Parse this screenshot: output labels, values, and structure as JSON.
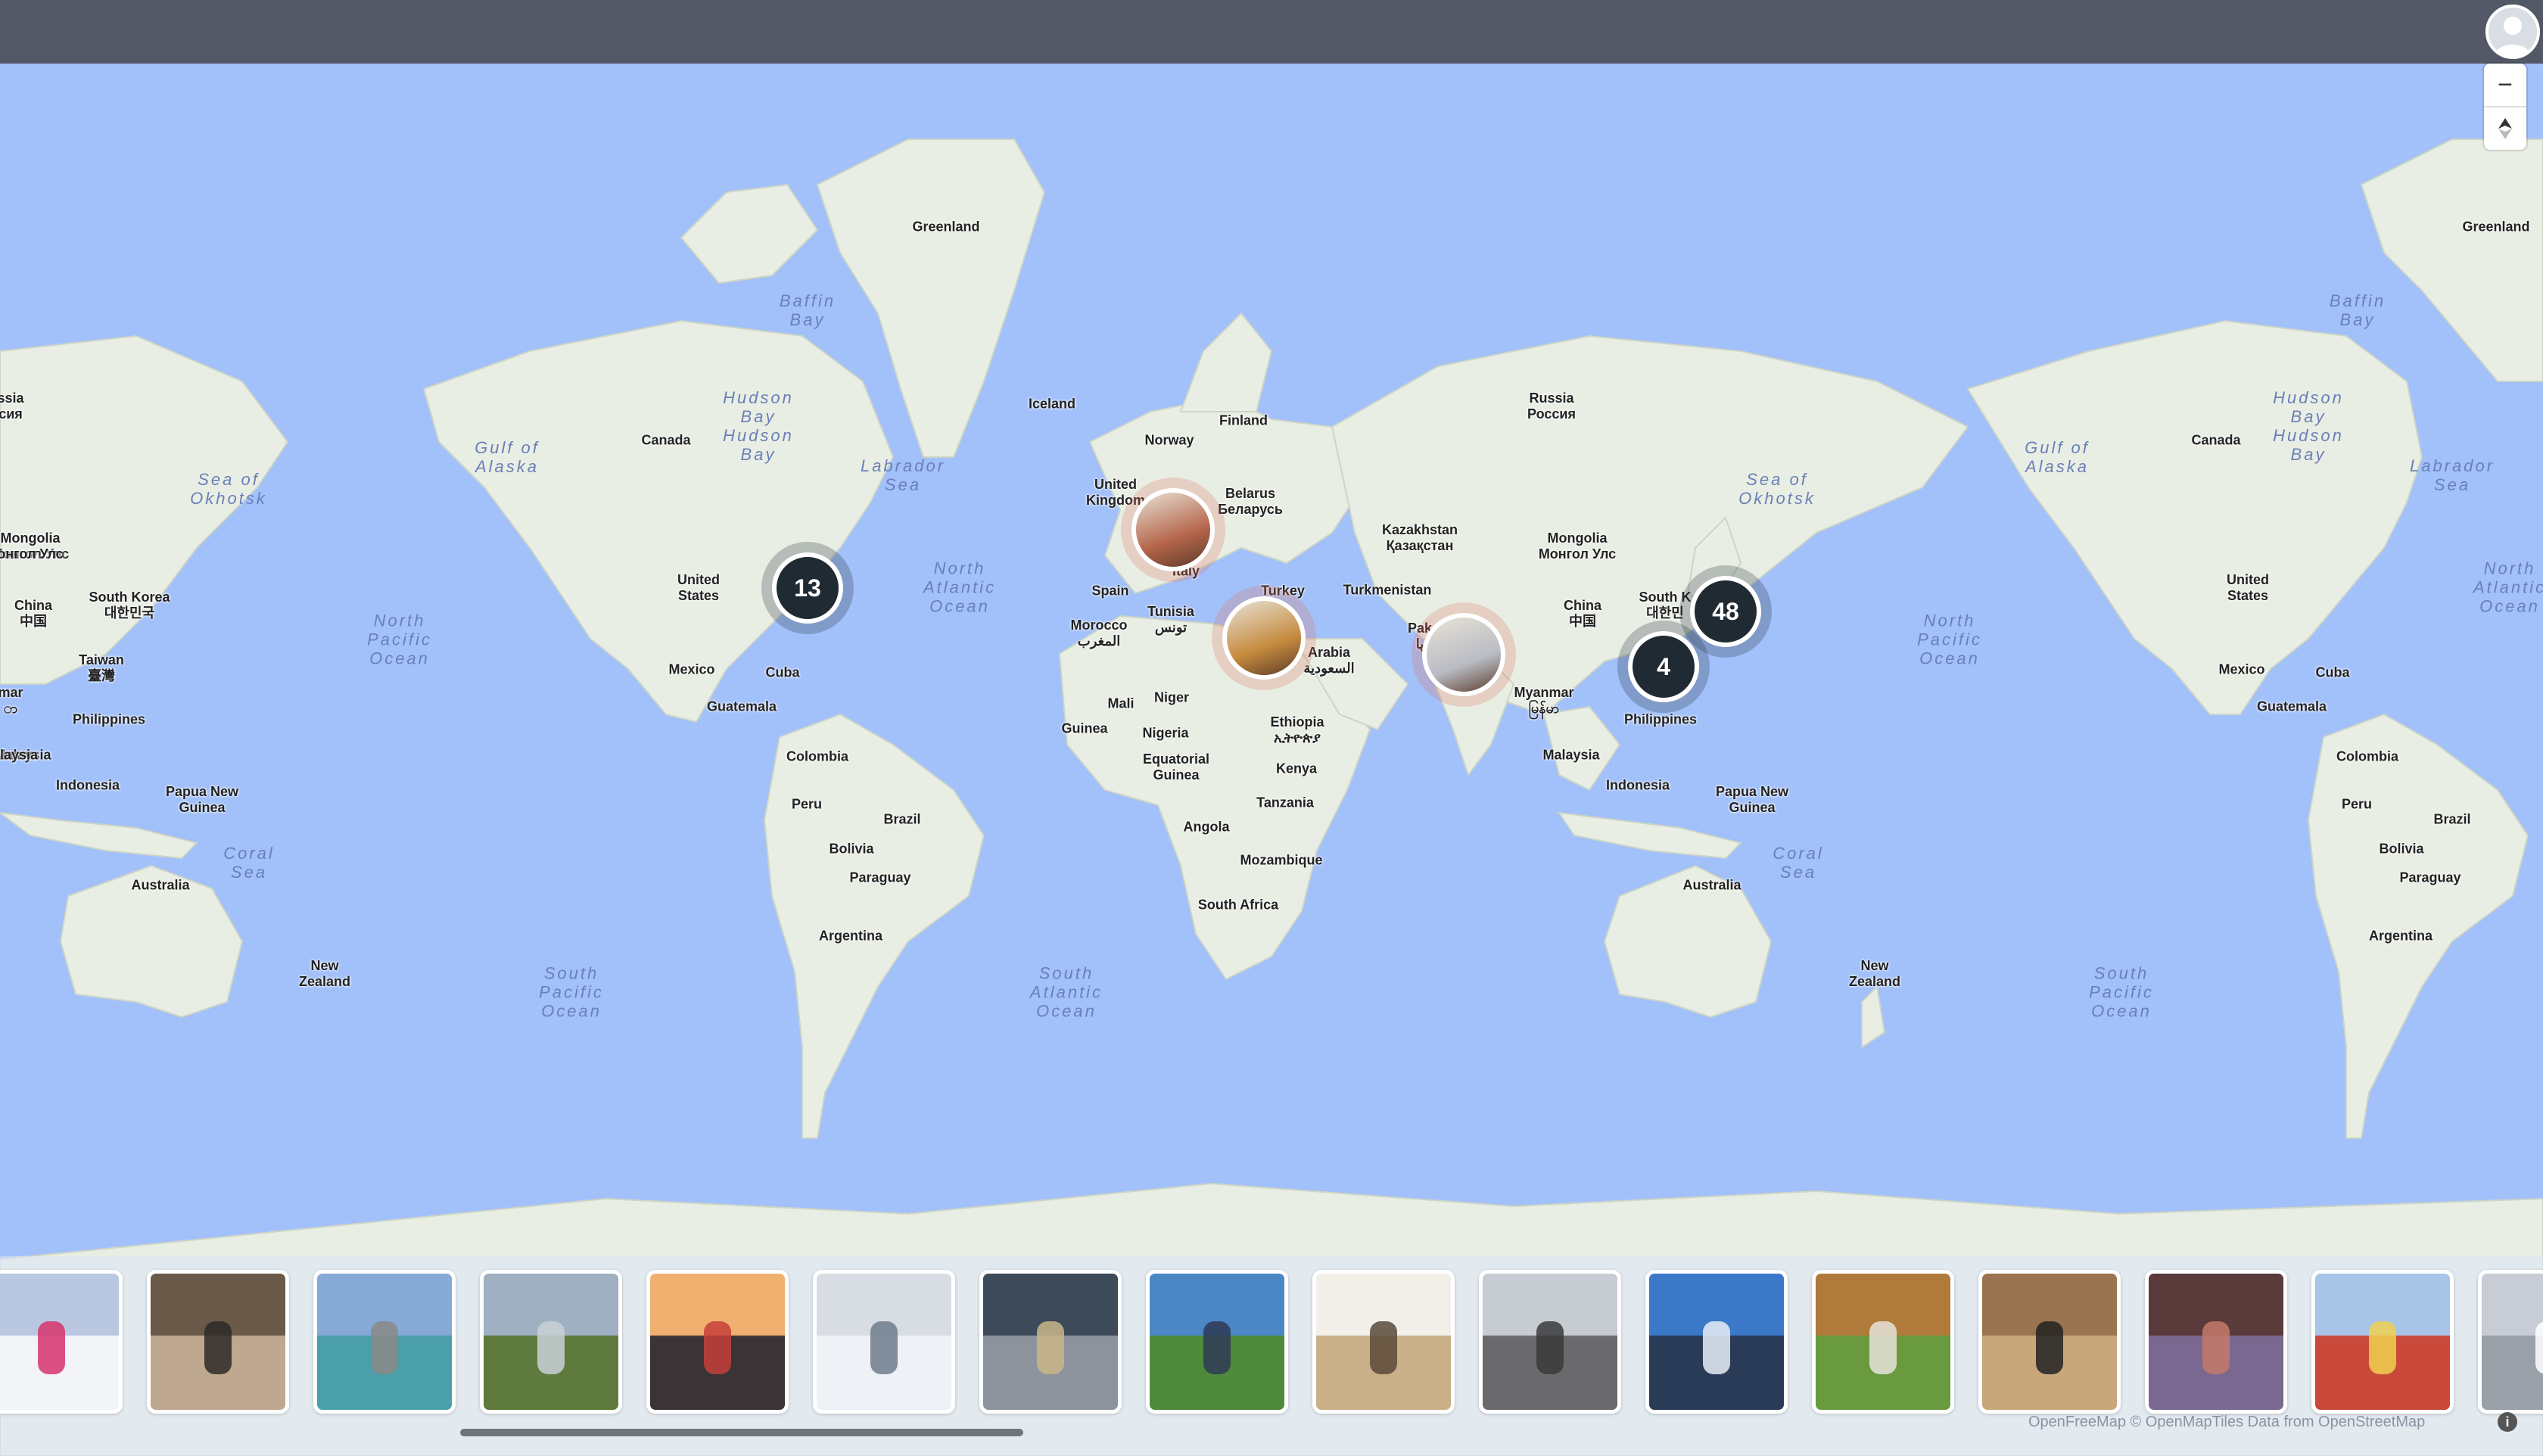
{
  "header": {},
  "map": {
    "land_color": "#e9eee4",
    "water_color": "#a2c0fa",
    "labels": [
      {
        "id": "greenland-1",
        "text": "Greenland"
      },
      {
        "id": "greenland-2",
        "text": "Greenland"
      },
      {
        "id": "iceland",
        "text": "Iceland"
      },
      {
        "id": "norway",
        "text": "Norway"
      },
      {
        "id": "finland",
        "text": "Finland"
      },
      {
        "id": "russia",
        "text": "Russia\nРоссия"
      },
      {
        "id": "canada-1",
        "text": "Canada"
      },
      {
        "id": "canada-2",
        "text": "Canada"
      },
      {
        "id": "united-states-1",
        "text": "United\nStates"
      },
      {
        "id": "united-states-2",
        "text": "United\nStates"
      },
      {
        "id": "mexico-1",
        "text": "Mexico"
      },
      {
        "id": "mexico-2",
        "text": "Mexico"
      },
      {
        "id": "cuba-1",
        "text": "Cuba"
      },
      {
        "id": "cuba-2",
        "text": "Cuba"
      },
      {
        "id": "guatemala-1",
        "text": "Guatemala"
      },
      {
        "id": "guatemala-2",
        "text": "Guatemala"
      },
      {
        "id": "colombia-1",
        "text": "Colombia"
      },
      {
        "id": "colombia-2",
        "text": "Colombia"
      },
      {
        "id": "peru-1",
        "text": "Peru"
      },
      {
        "id": "peru-2",
        "text": "Peru"
      },
      {
        "id": "brazil-1",
        "text": "Brazil"
      },
      {
        "id": "brazil-2",
        "text": "Brazil"
      },
      {
        "id": "bolivia-1",
        "text": "Bolivia"
      },
      {
        "id": "bolivia-2",
        "text": "Bolivia"
      },
      {
        "id": "paraguay-1",
        "text": "Paraguay"
      },
      {
        "id": "paraguay-2",
        "text": "Paraguay"
      },
      {
        "id": "argentina-1",
        "text": "Argentina"
      },
      {
        "id": "argentina-2",
        "text": "Argentina"
      },
      {
        "id": "united-kingdom",
        "text": "United\nKingdom"
      },
      {
        "id": "belarus",
        "text": "Belarus\nБеларусь"
      },
      {
        "id": "spain",
        "text": "Spain"
      },
      {
        "id": "italy",
        "text": "Italy"
      },
      {
        "id": "turkey",
        "text": "Turkey"
      },
      {
        "id": "morocco",
        "text": "Morocco\nالمغرب"
      },
      {
        "id": "tunisia",
        "text": "Tunisia\nتونس"
      },
      {
        "id": "saudi-arabia",
        "text": "Arabia\nالسعودية"
      },
      {
        "id": "mali",
        "text": "Mali"
      },
      {
        "id": "niger",
        "text": "Niger"
      },
      {
        "id": "guinea",
        "text": "Guinea"
      },
      {
        "id": "nigeria",
        "text": "Nigeria"
      },
      {
        "id": "ethiopia",
        "text": "Ethiopia\nኢትዮጵያ"
      },
      {
        "id": "equatorial-guinea",
        "text": "Equatorial\nGuinea"
      },
      {
        "id": "kenya",
        "text": "Kenya"
      },
      {
        "id": "tanzania",
        "text": "Tanzania"
      },
      {
        "id": "angola",
        "text": "Angola"
      },
      {
        "id": "mozambique",
        "text": "Mozambique"
      },
      {
        "id": "south-africa",
        "text": "South Africa"
      },
      {
        "id": "kazakhstan",
        "text": "Kazakhstan\nҚазақстан"
      },
      {
        "id": "turkmenistan",
        "text": "Turkmenistan"
      },
      {
        "id": "pakistan",
        "text": "Pak\nپا"
      },
      {
        "id": "mongolia-1",
        "text": "Mongolia\nМонгол Улс"
      },
      {
        "id": "mongolia-2",
        "text": "Mongolia\nМонгол Улс"
      },
      {
        "id": "china-1",
        "text": "China\n中国"
      },
      {
        "id": "china-2",
        "text": "China\n中国"
      },
      {
        "id": "south-korea-1",
        "text": "South Korea\n대한민국"
      },
      {
        "id": "south-korea-2",
        "text": "South K\n대한민"
      },
      {
        "id": "taiwan",
        "text": "Taiwan\n臺灣"
      },
      {
        "id": "myanmar",
        "text": "Myanmar\nမြန်မာ"
      },
      {
        "id": "philippines-1",
        "text": "Philippines"
      },
      {
        "id": "philippines-2",
        "text": "Philippines"
      },
      {
        "id": "malaysia-1",
        "text": "Malaysia"
      },
      {
        "id": "malaysia-2",
        "text": "Malaysia"
      },
      {
        "id": "indonesia-1",
        "text": "Indonesia"
      },
      {
        "id": "indonesia-2",
        "text": "Indonesia"
      },
      {
        "id": "png-1",
        "text": "Papua New\nGuinea"
      },
      {
        "id": "png-2",
        "text": "Papua New\nGuinea"
      },
      {
        "id": "australia-1",
        "text": "Australia"
      },
      {
        "id": "australia-2",
        "text": "Australia"
      },
      {
        "id": "new-zealand-1",
        "text": "New\nZealand"
      },
      {
        "id": "new-zealand-2",
        "text": "New\nZealand"
      },
      {
        "id": "russia-edge",
        "text": "ssia\nсия"
      },
      {
        "id": "mongolia-edge",
        "text": "Mongolia\nонгол Улс"
      },
      {
        "id": "myanmar-edge",
        "text": "mar\nာ"
      },
      {
        "id": "malaysia-edge",
        "text": "alaysia"
      }
    ],
    "oceans": [
      {
        "id": "baffin-1",
        "text": "Baffin\nBay"
      },
      {
        "id": "baffin-2",
        "text": "Baffin\nBay"
      },
      {
        "id": "hudson-1",
        "text": "Hudson\nBay\nHudson\nBay"
      },
      {
        "id": "hudson-2",
        "text": "Hudson\nBay\nHudson\nBay"
      },
      {
        "id": "labrador-1",
        "text": "Labrador\nSea"
      },
      {
        "id": "labrador-2",
        "text": "Labrador\nSea"
      },
      {
        "id": "gulf-alaska-1",
        "text": "Gulf of\nAlaska"
      },
      {
        "id": "gulf-alaska-2",
        "text": "Gulf of\nAlaska"
      },
      {
        "id": "okhotsk-1",
        "text": "Sea of\nOkhotsk"
      },
      {
        "id": "okhotsk-2",
        "text": "Sea of\nOkhotsk"
      },
      {
        "id": "north-atlantic-1",
        "text": "North\nAtlantic\nOcean"
      },
      {
        "id": "north-atlantic-2",
        "text": "North\nAtlantic\nOcean"
      },
      {
        "id": "north-pacific-1",
        "text": "North\nPacific\nOcean"
      },
      {
        "id": "north-pacific-2",
        "text": "North\nPacific\nOcean"
      },
      {
        "id": "coral-1",
        "text": "Coral\nSea"
      },
      {
        "id": "coral-2",
        "text": "Coral\nSea"
      },
      {
        "id": "south-pacific-1",
        "text": "South\nPacific\nOcean"
      },
      {
        "id": "south-pacific-2",
        "text": "South\nPacific\nOcean"
      },
      {
        "id": "south-atlantic",
        "text": "South\nAtlantic\nOcean"
      }
    ],
    "clusters": [
      {
        "id": "americas",
        "count": "13"
      },
      {
        "id": "japan",
        "count": "48"
      },
      {
        "id": "taiwan-area",
        "count": "4"
      }
    ],
    "photo_markers": [
      {
        "id": "europe",
        "color": "#b5654a"
      },
      {
        "id": "middle-east",
        "color": "#c58a3d"
      },
      {
        "id": "india",
        "color": "#b9bcc4"
      }
    ]
  },
  "controls": {
    "zoom_out_icon": "minus-icon",
    "compass_icon": "compass-icon"
  },
  "attribution": "OpenFreeMap © OpenMapTiles Data from OpenStreetMap",
  "photo_strip": [
    {
      "sky": "#b9c8e0",
      "ground": "#f2f4f8",
      "accent": "#d6346c"
    },
    {
      "sky": "#6b5a4a",
      "ground": "#bfa890",
      "accent": "#2e2a28"
    },
    {
      "sky": "#86a9d6",
      "ground": "#4a9fa8",
      "accent": "#8a8a86"
    },
    {
      "sky": "#9fb0c2",
      "ground": "#5e7a3c",
      "accent": "#c9d0d6"
    },
    {
      "sky": "#f0b070",
      "ground": "#3a3436",
      "accent": "#c7403a"
    },
    {
      "sky": "#d8dde4",
      "ground": "#eef1f5",
      "accent": "#6f7c8c"
    },
    {
      "sky": "#3d4a5a",
      "ground": "#8c939c",
      "accent": "#c9b68a"
    },
    {
      "sky": "#4b87c4",
      "ground": "#4e8a3a",
      "accent": "#2f3a56"
    },
    {
      "sky": "#f1efe8",
      "ground": "#c9b089",
      "accent": "#5a4a3a"
    },
    {
      "sky": "#c7ccd3",
      "ground": "#6a6a6c",
      "accent": "#3a3a3a"
    },
    {
      "sky": "#3b78c8",
      "ground": "#2a3b58",
      "accent": "#e8eef6"
    },
    {
      "sky": "#b07a3a",
      "ground": "#6a9a3e",
      "accent": "#e8e4dc"
    },
    {
      "sky": "#9a7450",
      "ground": "#c8a77a",
      "accent": "#222222"
    },
    {
      "sky": "#5a3a3a",
      "ground": "#7a6890",
      "accent": "#c47a6a"
    },
    {
      "sky": "#a8c4e6",
      "ground": "#c94a3a",
      "accent": "#f0d050"
    },
    {
      "sky": "#c8ccd4",
      "ground": "#9aa0a8",
      "accent": "#ffffff"
    }
  ]
}
